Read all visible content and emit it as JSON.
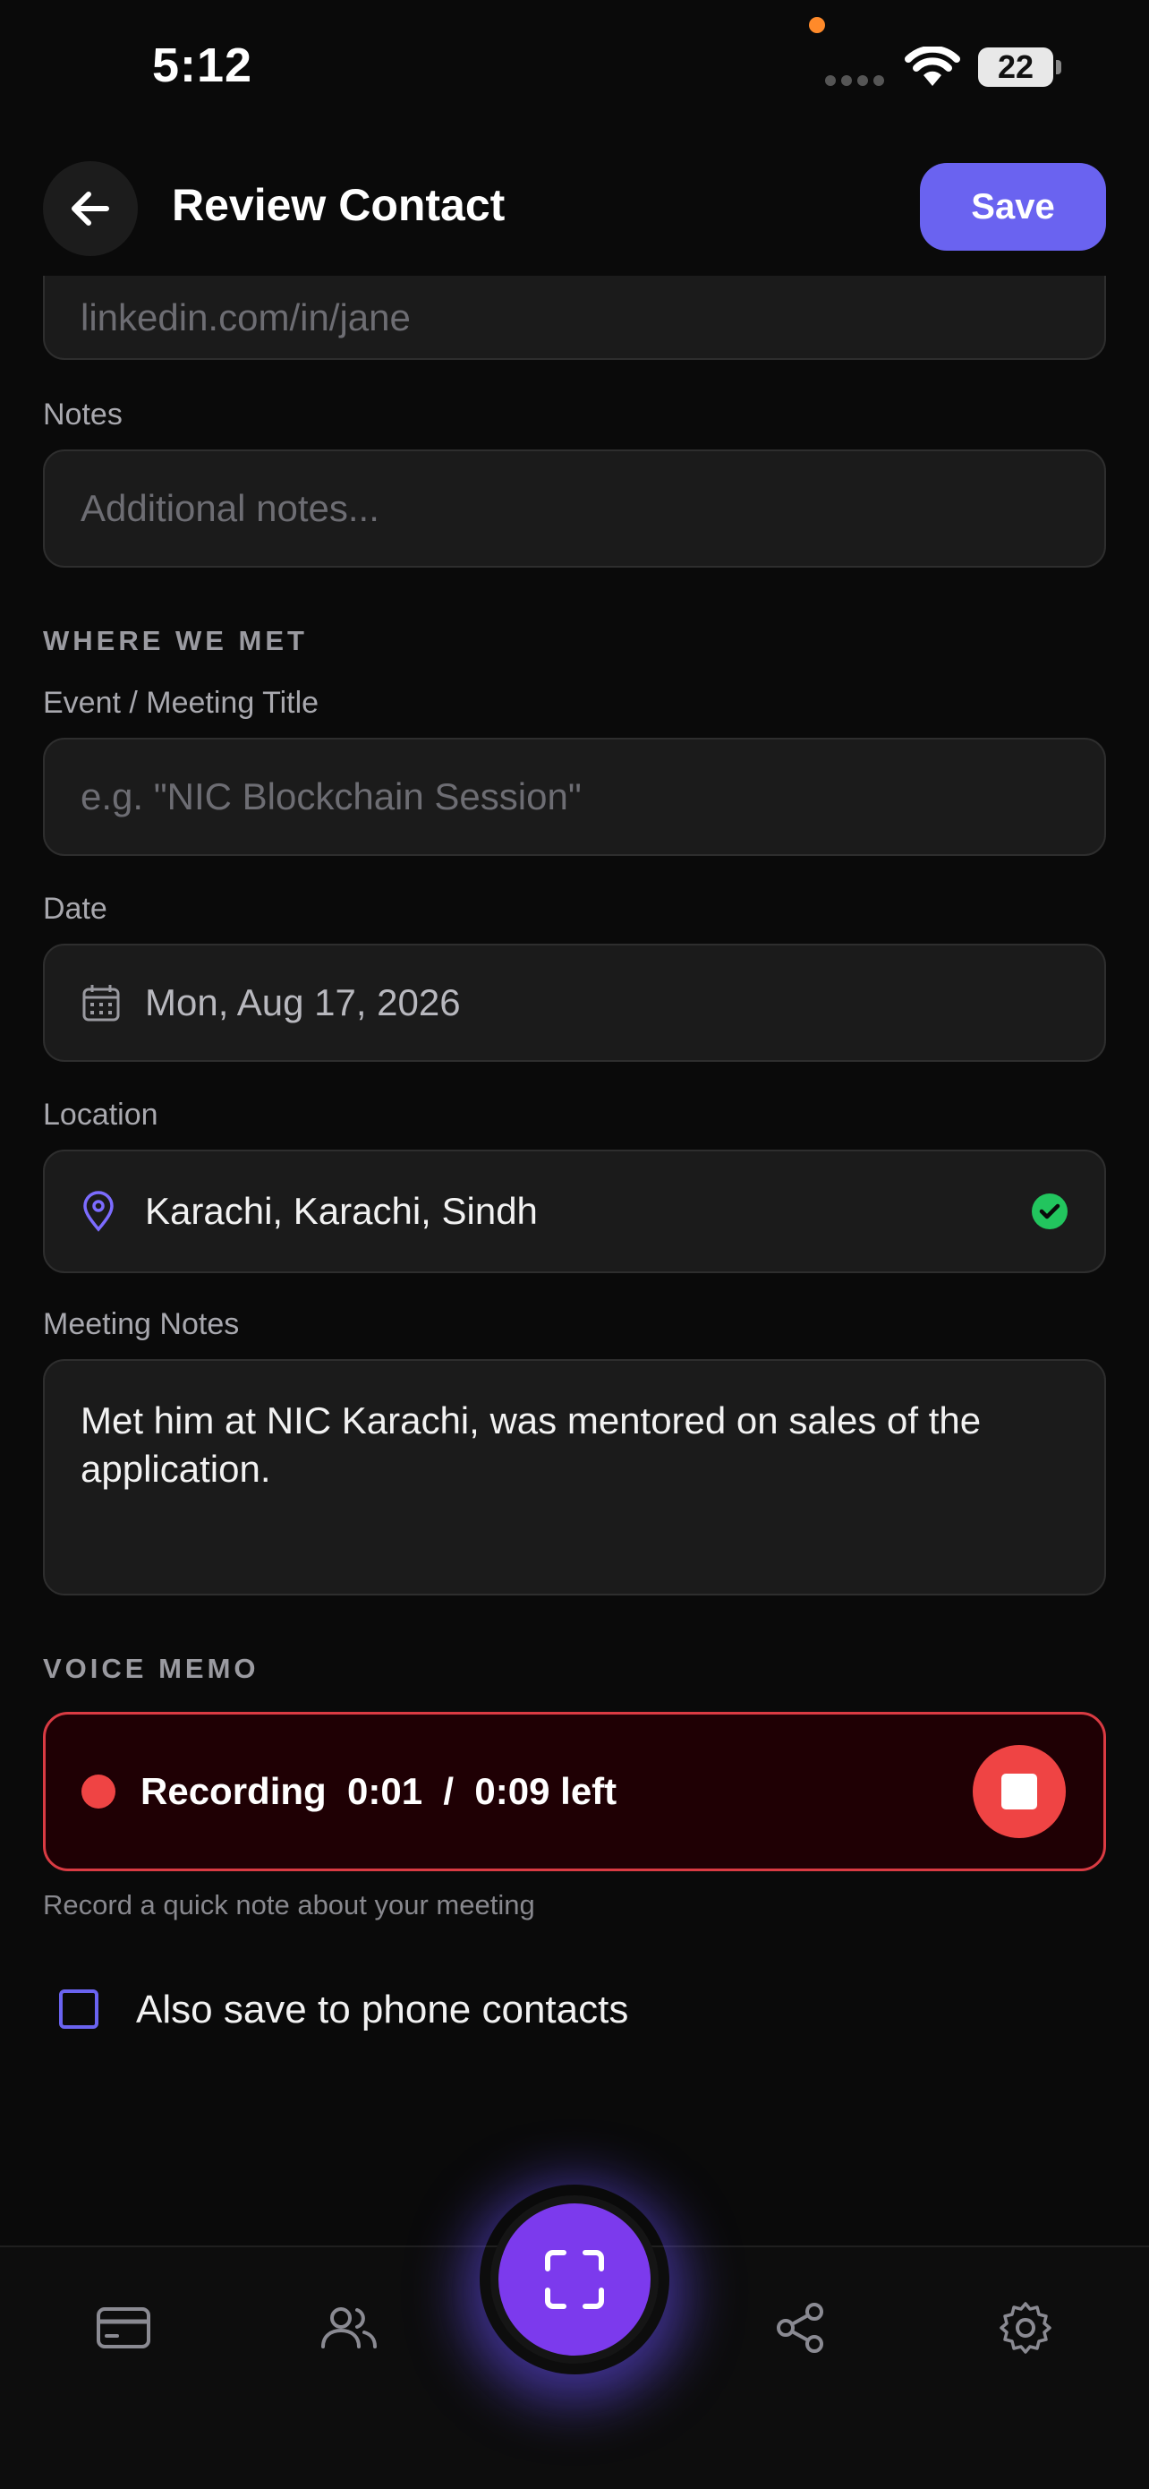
{
  "status": {
    "time": "5:12",
    "battery": "22"
  },
  "header": {
    "title": "Review Contact",
    "save_label": "Save"
  },
  "form": {
    "linkedin_placeholder": "linkedin.com/in/jane",
    "notes_label": "Notes",
    "notes_placeholder": "Additional notes...",
    "where_we_met_heading": "WHERE WE MET",
    "event_label": "Event / Meeting Title",
    "event_placeholder": "e.g. \"NIC Blockchain Session\"",
    "date_label": "Date",
    "date_value": "Mon, Aug 17, 2026",
    "location_label": "Location",
    "location_value": "Karachi, Karachi, Sindh",
    "meeting_notes_label": "Meeting Notes",
    "meeting_notes_value": "Met him at NIC Karachi, was mentored on sales of the application."
  },
  "voice_memo": {
    "heading": "VOICE MEMO",
    "recording_text": "Recording  0:01  /  0:09 left",
    "hint": "Record a quick note about your meeting"
  },
  "phone_contacts": {
    "label": "Also save to phone contacts",
    "checked": false
  },
  "tabbar": {
    "items": [
      "card-icon",
      "contacts-icon",
      "scan-icon",
      "share-icon",
      "settings-icon"
    ],
    "active": "scan-icon"
  },
  "colors": {
    "accent": "#6a63f0",
    "scan": "#7c3aed",
    "recording": "#ef4444",
    "success": "#22c55e"
  }
}
